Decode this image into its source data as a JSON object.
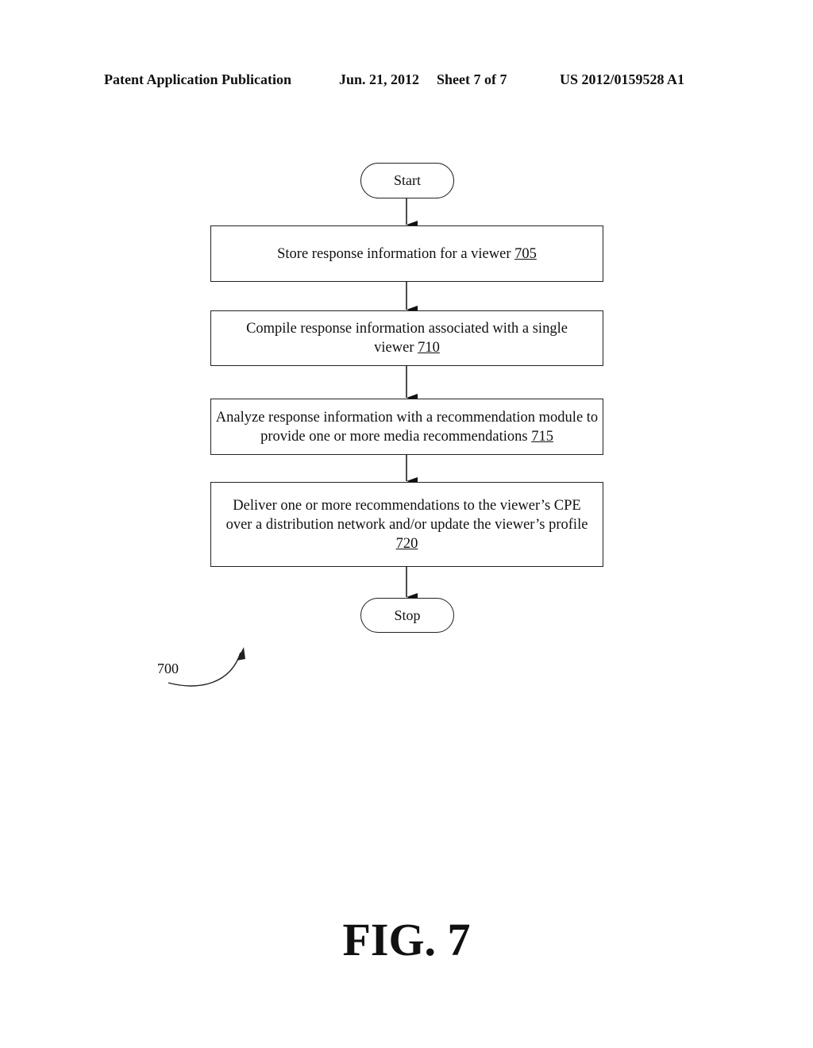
{
  "header": {
    "publication": "Patent Application Publication",
    "date": "Jun. 21, 2012",
    "sheet": "Sheet 7 of 7",
    "patent_number": "US 2012/0159528 A1"
  },
  "flowchart": {
    "start_label": "Start",
    "stop_label": "Stop",
    "steps": [
      {
        "text": "Store response information for a viewer",
        "ref": "705"
      },
      {
        "text": "Compile response information associated with a single viewer",
        "ref": "710"
      },
      {
        "text": "Analyze response information with a recommendation module to provide one or more media recommendations",
        "ref": "715"
      },
      {
        "text": "Deliver one or more recommendations to the viewer’s CPE over a distribution network and/or update the viewer’s profile",
        "ref": "720"
      }
    ]
  },
  "figure_ref": "700",
  "figure_label": "FIG. 7"
}
